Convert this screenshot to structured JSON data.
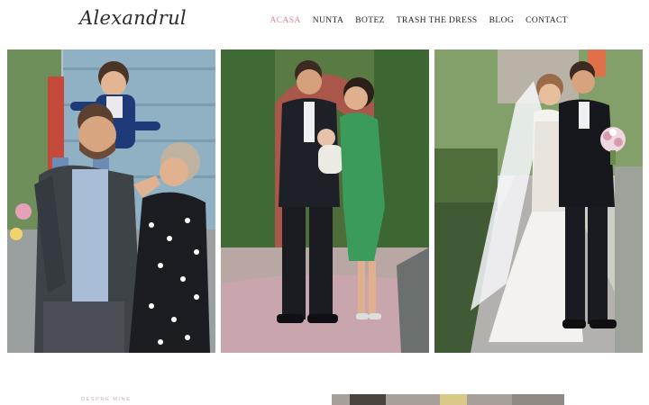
{
  "header": {
    "logo_text": "Alexandrul",
    "nav": [
      {
        "label": "ACASA",
        "active": true
      },
      {
        "label": "NUNTA",
        "active": false
      },
      {
        "label": "BOTEZ",
        "active": false
      },
      {
        "label": "TRASH THE DRESS",
        "active": false
      },
      {
        "label": "BLOG",
        "active": false
      },
      {
        "label": "CONTACT",
        "active": false
      }
    ]
  },
  "hero": {
    "photos": [
      {
        "icon": "family-photo"
      },
      {
        "icon": "baptism-family-photo"
      },
      {
        "icon": "wedding-couple-photo"
      }
    ]
  },
  "about": {
    "label": "DESPRE MINE"
  },
  "colors": {
    "accent": "#d98b93",
    "text": "#222222",
    "background": "#ffffff"
  }
}
